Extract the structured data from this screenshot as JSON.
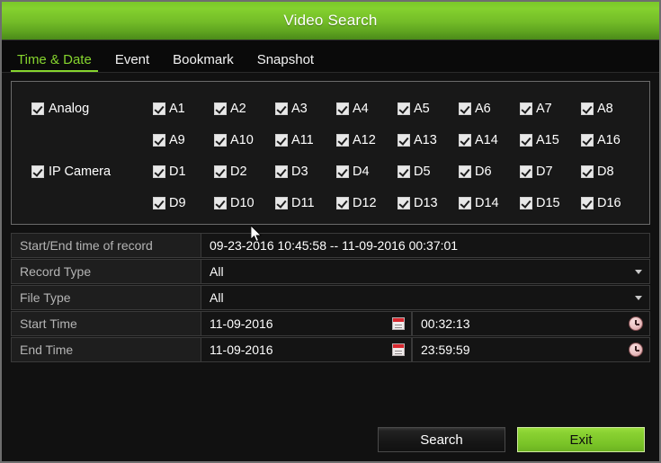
{
  "window": {
    "title": "Video Search"
  },
  "tabs": [
    {
      "label": "Time & Date",
      "active": true
    },
    {
      "label": "Event",
      "active": false
    },
    {
      "label": "Bookmark",
      "active": false
    },
    {
      "label": "Snapshot",
      "active": false
    }
  ],
  "camera_panel": {
    "groups": [
      {
        "label": "Analog",
        "checked": true,
        "rows": [
          [
            {
              "label": "A1",
              "checked": true
            },
            {
              "label": "A2",
              "checked": true
            },
            {
              "label": "A3",
              "checked": true
            },
            {
              "label": "A4",
              "checked": true
            },
            {
              "label": "A5",
              "checked": true
            },
            {
              "label": "A6",
              "checked": true
            },
            {
              "label": "A7",
              "checked": true
            },
            {
              "label": "A8",
              "checked": true
            }
          ],
          [
            {
              "label": "A9",
              "checked": true
            },
            {
              "label": "A10",
              "checked": true
            },
            {
              "label": "A11",
              "checked": true
            },
            {
              "label": "A12",
              "checked": true
            },
            {
              "label": "A13",
              "checked": true
            },
            {
              "label": "A14",
              "checked": true
            },
            {
              "label": "A15",
              "checked": true
            },
            {
              "label": "A16",
              "checked": true
            }
          ]
        ]
      },
      {
        "label": "IP Camera",
        "checked": true,
        "rows": [
          [
            {
              "label": "D1",
              "checked": true
            },
            {
              "label": "D2",
              "checked": true
            },
            {
              "label": "D3",
              "checked": true
            },
            {
              "label": "D4",
              "checked": true
            },
            {
              "label": "D5",
              "checked": true
            },
            {
              "label": "D6",
              "checked": true
            },
            {
              "label": "D7",
              "checked": true
            },
            {
              "label": "D8",
              "checked": true
            }
          ],
          [
            {
              "label": "D9",
              "checked": true
            },
            {
              "label": "D10",
              "checked": true
            },
            {
              "label": "D11",
              "checked": true
            },
            {
              "label": "D12",
              "checked": true
            },
            {
              "label": "D13",
              "checked": true
            },
            {
              "label": "D14",
              "checked": true
            },
            {
              "label": "D15",
              "checked": true
            },
            {
              "label": "D16",
              "checked": true
            }
          ]
        ]
      }
    ]
  },
  "form": {
    "record_range": {
      "label": "Start/End time of record",
      "value": "09-23-2016 10:45:58 -- 11-09-2016 00:37:01"
    },
    "record_type": {
      "label": "Record Type",
      "value": "All"
    },
    "file_type": {
      "label": "File Type",
      "value": "All"
    },
    "start_time": {
      "label": "Start Time",
      "date": "11-09-2016",
      "time": "00:32:13"
    },
    "end_time": {
      "label": "End Time",
      "date": "11-09-2016",
      "time": "23:59:59"
    }
  },
  "footer": {
    "search_label": "Search",
    "exit_label": "Exit"
  },
  "colors": {
    "title_green": "#7ac82a",
    "accent_green": "#86d52e",
    "exit_green": "#8ad232",
    "panel_bg": "#181818",
    "window_bg": "#111111",
    "label_text": "#b4b4b4",
    "calendar_red": "#d8282f"
  }
}
